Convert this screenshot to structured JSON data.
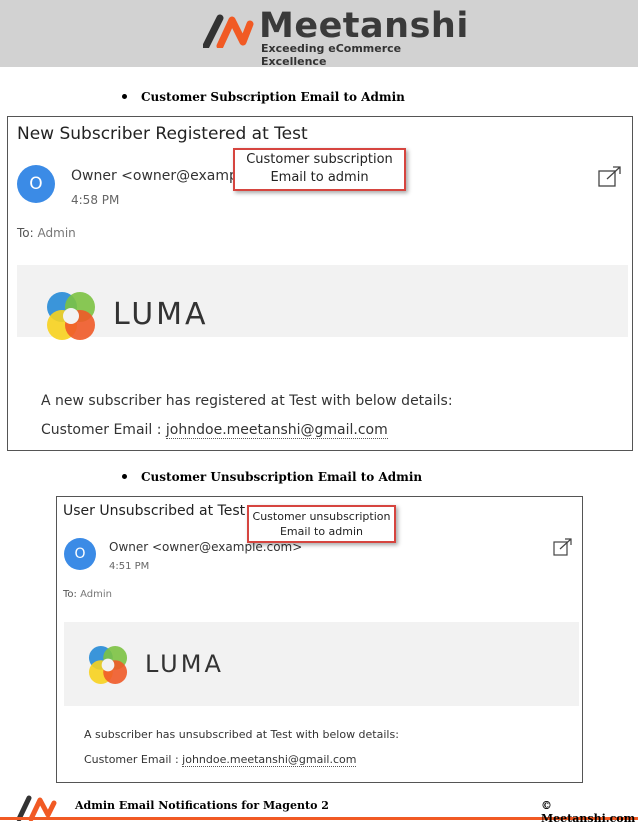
{
  "header": {
    "brand_name": "Meetanshi",
    "tagline": "Exceeding eCommerce Excellence"
  },
  "sections": [
    {
      "bullet": "Customer Subscription Email to Admin",
      "email": {
        "subject": "New Subscriber Registered at Test",
        "avatar_letter": "O",
        "sender": "Owner <owner@example.com>",
        "time": "4:58 PM",
        "to_label": "To:",
        "to_value": "Admin",
        "logo_text": "LUMA",
        "body_line": "A new subscriber has registered at Test with below details:",
        "email_label": "Customer Email :",
        "email_value": "johndoe.meetanshi@gmail.com"
      },
      "callout": {
        "line1": "Customer subscription",
        "line2": "Email to admin"
      }
    },
    {
      "bullet": "Customer Unsubscription Email to Admin",
      "email": {
        "subject": "User Unsubscribed at Test",
        "avatar_letter": "O",
        "sender": "Owner <owner@example.com>",
        "time": "4:51 PM",
        "to_label": "To:",
        "to_value": "Admin",
        "logo_text": "LUMA",
        "body_line": "A subscriber has unsubscribed at Test with below details:",
        "email_label": "Customer Email :",
        "email_value": "johndoe.meetanshi@gmail.com"
      },
      "callout": {
        "line1": "Customer unsubscription",
        "line2": "Email to admin"
      }
    }
  ],
  "footer": {
    "left": "Admin Email Notifications for Magento 2",
    "right": "© Meetanshi.com"
  },
  "colors": {
    "accent_orange": "#f15a24",
    "callout_red": "#d6453f",
    "avatar_blue": "#3b8be6",
    "banner_gray": "#d2d2d2"
  },
  "icons": [
    "meetanshi-logo-icon",
    "popout-icon",
    "luma-logo-icon"
  ]
}
